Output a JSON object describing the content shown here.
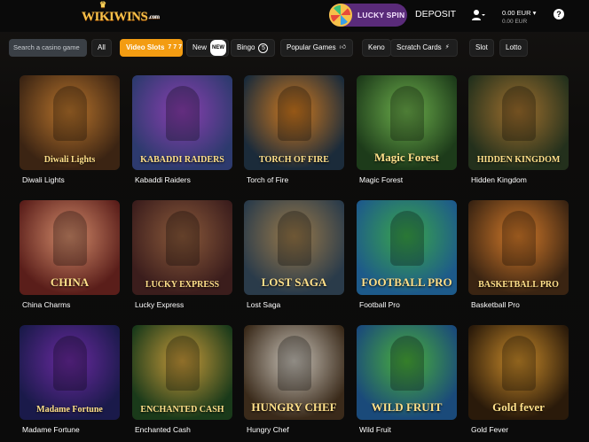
{
  "header": {
    "logo_text": "WIKIWINS",
    "logo_suffix": ".com",
    "lucky_spin_label": "LUCKY SPIN",
    "deposit_label": "DEPOSIT",
    "balance_main": "0.00 EUR",
    "balance_sub": "0.00 EUR",
    "help_label": "?"
  },
  "nav": {
    "search_placeholder": "Search a casino game",
    "categories": [
      "All",
      "Video Slots",
      "New",
      "Bingo",
      "Popular Games",
      "Keno",
      "Scratch Cards",
      "Slot",
      "Lotto"
    ],
    "active_category": "Video Slots"
  },
  "games": [
    {
      "name": "Diwali Lights",
      "art_text": "Diwali Lights",
      "bg1": "#3b2413",
      "bg2": "#b8742c"
    },
    {
      "name": "Kabaddi Raiders",
      "art_text": "KABADDI RAIDERS",
      "bg1": "#2d3a6e",
      "bg2": "#8a3fb0"
    },
    {
      "name": "Torch of Fire",
      "art_text": "TORCH OF FIRE",
      "bg1": "#1b2b3a",
      "bg2": "#d07a1f"
    },
    {
      "name": "Magic Forest",
      "art_text": "Magic Forest",
      "bg1": "#1d3b1a",
      "bg2": "#6cae4b"
    },
    {
      "name": "Hidden Kingdom",
      "art_text": "HIDDEN KINGDOM",
      "bg1": "#23301c",
      "bg2": "#a0702e"
    },
    {
      "name": "China Charms",
      "art_text": "CHINA",
      "bg1": "#5a1e1a",
      "bg2": "#d28b6a"
    },
    {
      "name": "Lucky Express",
      "art_text": "LUCKY EXPRESS",
      "bg1": "#3b1d1c",
      "bg2": "#8b5a3b"
    },
    {
      "name": "Lost Saga",
      "art_text": "LOST SAGA",
      "bg1": "#2a3b4a",
      "bg2": "#9a7a4a"
    },
    {
      "name": "Football Pro",
      "art_text": "FOOTBALL PRO",
      "bg1": "#1d5a8a",
      "bg2": "#3aa64a"
    },
    {
      "name": "Basketball Pro",
      "art_text": "BASKETBALL PRO",
      "bg1": "#3a2412",
      "bg2": "#d37a2a"
    },
    {
      "name": "Madame Fortune",
      "art_text": "Madame Fortune",
      "bg1": "#1a1a4a",
      "bg2": "#6a2aa0"
    },
    {
      "name": "Enchanted Cash",
      "art_text": "ENCHANTED CASH",
      "bg1": "#1a3a1a",
      "bg2": "#c89a3a"
    },
    {
      "name": "Hungry Chef",
      "art_text": "HUNGRY CHEF",
      "bg1": "#3a2a1a",
      "bg2": "#c8c2b8"
    },
    {
      "name": "Wild Fruit",
      "art_text": "WILD FRUIT",
      "bg1": "#1a4a7a",
      "bg2": "#4ab03a"
    },
    {
      "name": "Gold Fever",
      "art_text": "Gold fever",
      "bg1": "#2a1a0a",
      "bg2": "#c88a2a"
    }
  ]
}
